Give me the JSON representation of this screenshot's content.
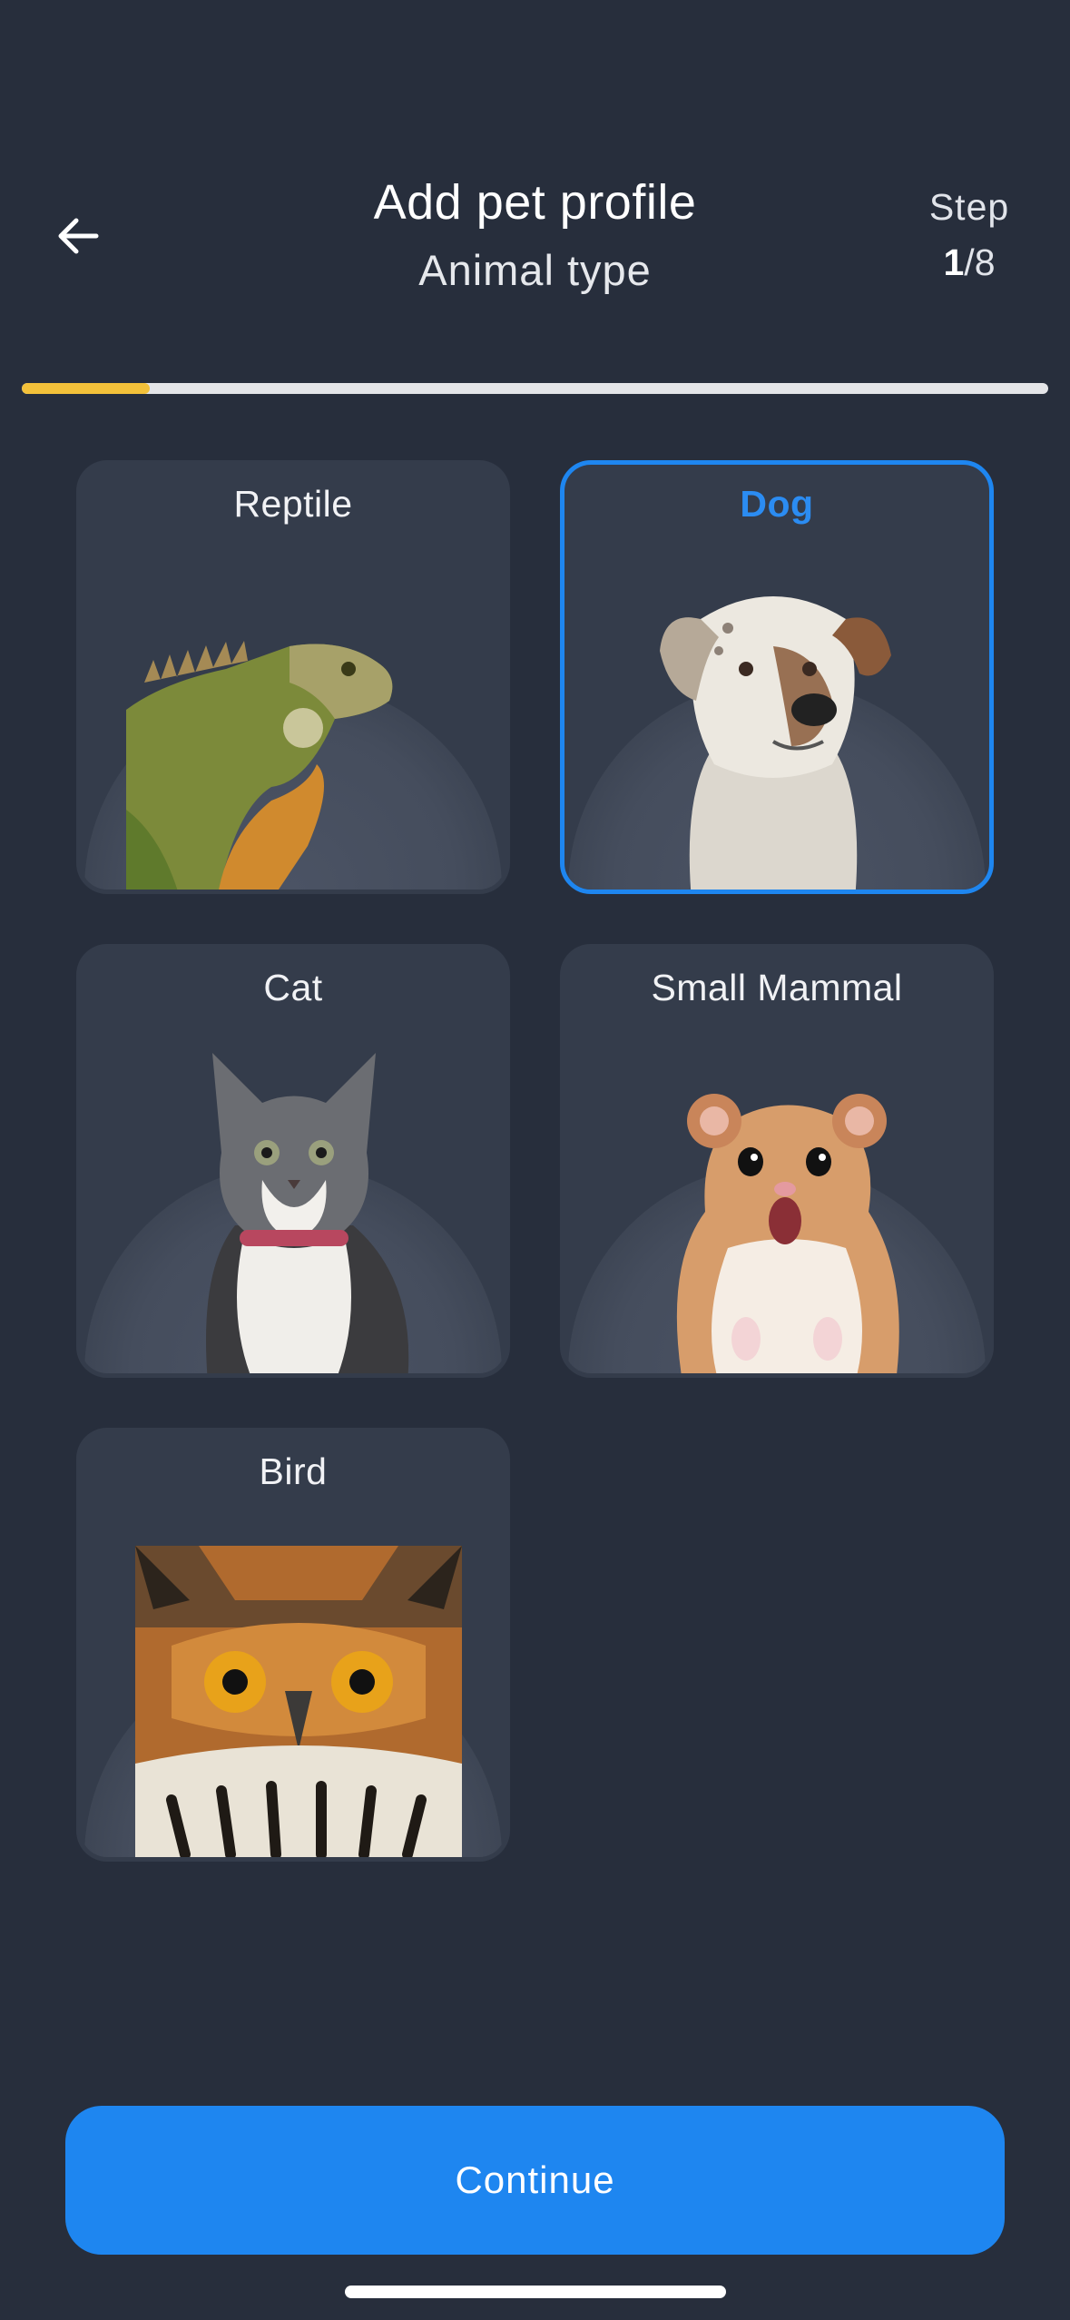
{
  "header": {
    "title": "Add pet profile",
    "subtitle": "Animal type",
    "step_label": "Step",
    "step_current": "1",
    "step_total": "/8"
  },
  "progress": {
    "fraction": 0.125,
    "fill_color": "#f3c13a"
  },
  "animal_types": [
    {
      "label": "Reptile",
      "image": "iguana",
      "selected": false
    },
    {
      "label": "Dog",
      "image": "dog",
      "selected": true
    },
    {
      "label": "Cat",
      "image": "cat",
      "selected": false
    },
    {
      "label": "Small Mammal",
      "image": "hamster",
      "selected": false
    },
    {
      "label": "Bird",
      "image": "owl",
      "selected": false
    }
  ],
  "footer": {
    "continue_label": "Continue"
  },
  "colors": {
    "background": "#272e3c",
    "card": "#343c4b",
    "accent": "#1e86f0"
  }
}
